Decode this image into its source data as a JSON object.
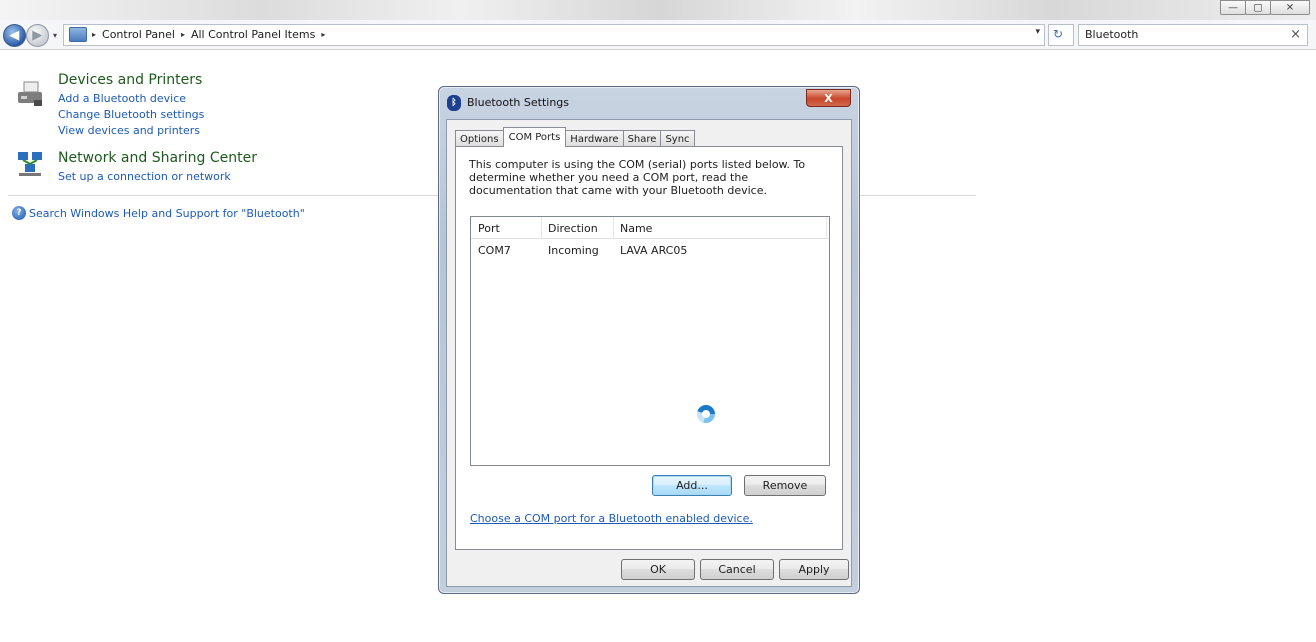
{
  "window": {
    "minimize_glyph": "—",
    "maximize_glyph": "▢",
    "close_glyph": "✕"
  },
  "nav": {
    "back_glyph": "◀",
    "forward_glyph": "▶",
    "recent_glyph": "▾"
  },
  "address": {
    "crumbs": [
      "Control Panel",
      "All Control Panel Items"
    ],
    "separator": "▸",
    "dropdown_glyph": "▾",
    "refresh_glyph": "↻"
  },
  "search": {
    "value": "Bluetooth",
    "clear_glyph": "×"
  },
  "groups": [
    {
      "title": "Devices and Printers",
      "icon": "printer-icon",
      "links": [
        "Add a Bluetooth device",
        "Change Bluetooth settings",
        "View devices and printers"
      ]
    },
    {
      "title": "Network and Sharing Center",
      "icon": "network-icon",
      "links": [
        "Set up a connection or network"
      ]
    }
  ],
  "help": {
    "text": "Search Windows Help and Support for \"Bluetooth\"",
    "icon_glyph": "?"
  },
  "dialog": {
    "title": "Bluetooth Settings",
    "icon_glyph": "ᛒ",
    "close_glyph": "X",
    "tabs": [
      "Options",
      "COM Ports",
      "Hardware",
      "Share",
      "Sync"
    ],
    "active_tab": "COM Ports",
    "description": "This computer is using the COM (serial) ports listed below. To determine whether you need a COM port, read the documentation that came with your Bluetooth device.",
    "columns": [
      "Port",
      "Direction",
      "Name"
    ],
    "rows": [
      {
        "port": "COM7",
        "direction": "Incoming",
        "name": "LAVA ARC05"
      }
    ],
    "add_label": "Add...",
    "remove_label": "Remove",
    "link_text": "Choose a COM port for a Bluetooth enabled device.",
    "ok_label": "OK",
    "cancel_label": "Cancel",
    "apply_label": "Apply"
  },
  "colors": {
    "link": "#1c5ab8",
    "group_title": "#1e5a1e",
    "close_red": "#c7462b"
  }
}
